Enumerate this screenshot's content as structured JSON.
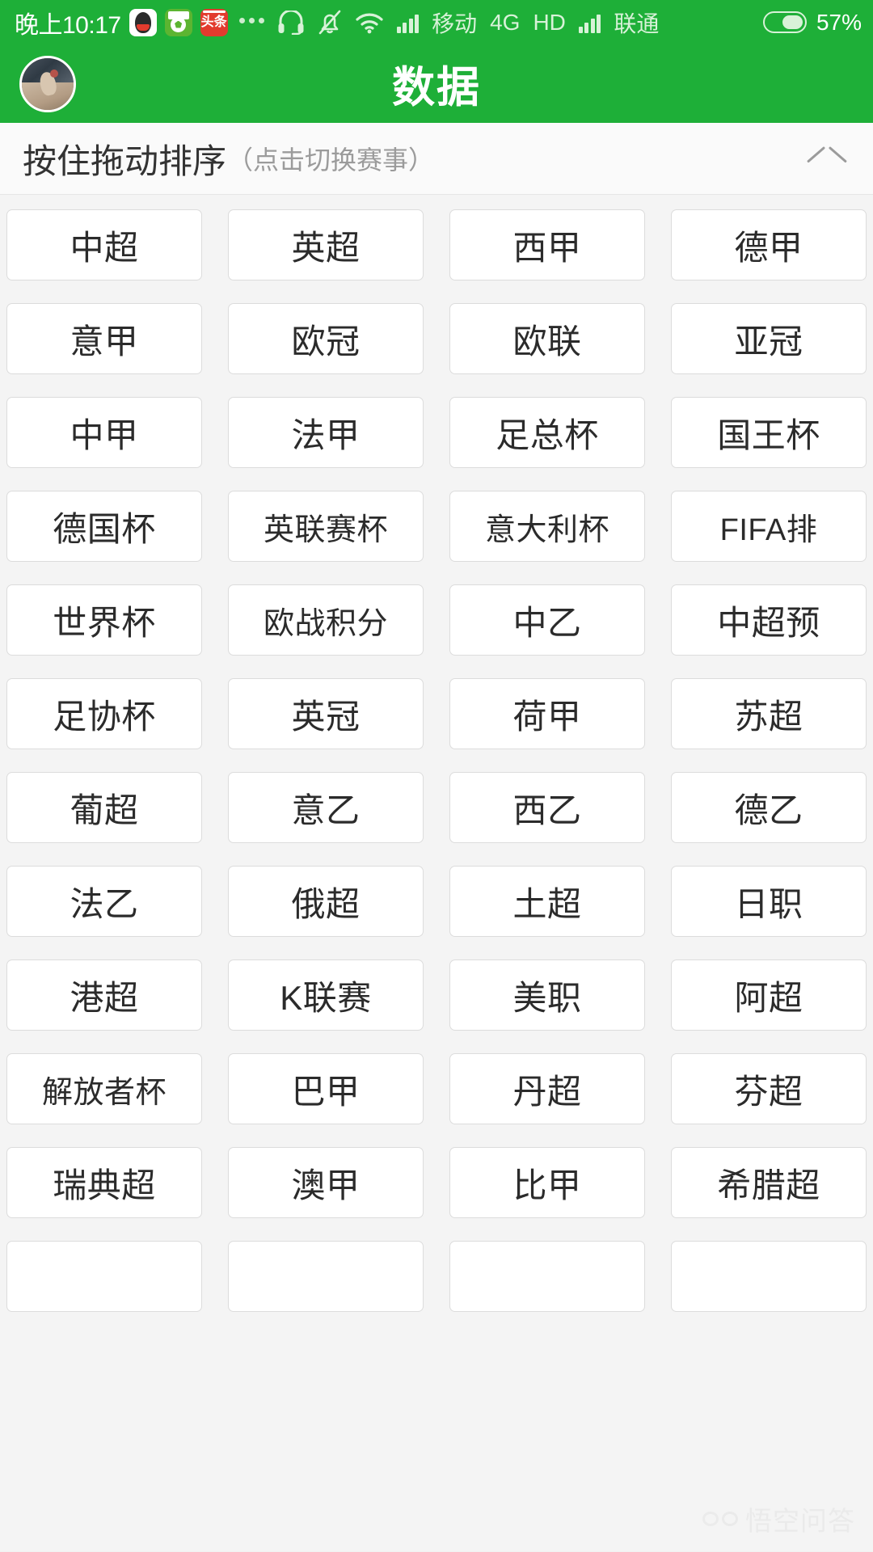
{
  "status_bar": {
    "clock": "晚上10:17",
    "app_icons": [
      {
        "name": "qq-icon",
        "label": "QQ"
      },
      {
        "name": "football-app-icon",
        "label": "足球"
      },
      {
        "name": "toutiao-icon",
        "label": "头条"
      }
    ],
    "overflow_dots": "•••",
    "icons": [
      "headset-icon",
      "bell-muted-icon",
      "wifi-icon",
      "signal-icon"
    ],
    "carrier_primary": "移动",
    "network_type": "4G",
    "hd_label": "HD",
    "carrier_secondary": "联通",
    "battery_percent": "57%",
    "battery_level": 57
  },
  "title_bar": {
    "title": "数据",
    "avatar_name": "user-avatar"
  },
  "sort_bar": {
    "main_text": "按住拖动排序",
    "sub_text": "（点击切换赛事）",
    "collapse_icon": "chevron-up-icon"
  },
  "leagues": [
    "中超",
    "英超",
    "西甲",
    "德甲",
    "意甲",
    "欧冠",
    "欧联",
    "亚冠",
    "中甲",
    "法甲",
    "足总杯",
    "国王杯",
    "德国杯",
    "英联赛杯",
    "意大利杯",
    "FIFA排",
    "世界杯",
    "欧战积分",
    "中乙",
    "中超预",
    "足协杯",
    "英冠",
    "荷甲",
    "苏超",
    "葡超",
    "意乙",
    "西乙",
    "德乙",
    "法乙",
    "俄超",
    "土超",
    "日职",
    "港超",
    "K联赛",
    "美职",
    "阿超",
    "解放者杯",
    "巴甲",
    "丹超",
    "芬超",
    "瑞典超",
    "澳甲",
    "比甲",
    "希腊超",
    "",
    "",
    "",
    ""
  ],
  "watermark": {
    "text": "悟空问答",
    "logo_name": "wukong-logo-icon"
  },
  "colors": {
    "brand_green": "#1eaf38",
    "page_background": "#f4f4f4",
    "button_background": "#ffffff",
    "button_border": "#dcdcdc",
    "text_primary": "#2b2b2b",
    "text_muted": "#9b9b9b"
  }
}
